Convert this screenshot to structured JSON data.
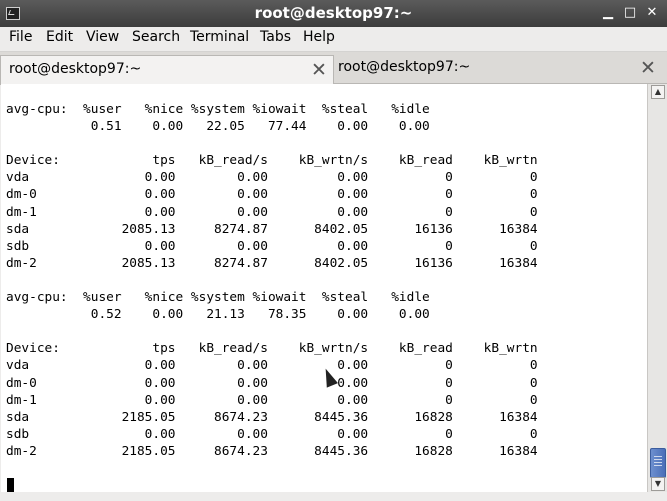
{
  "window": {
    "title": "root@desktop97:~"
  },
  "window_controls": {
    "minimize": "▁",
    "maximize": "□",
    "close": "✕"
  },
  "menu": [
    {
      "label": "File"
    },
    {
      "label": "Edit"
    },
    {
      "label": "View"
    },
    {
      "label": "Search"
    },
    {
      "label": "Terminal"
    },
    {
      "label": "Tabs"
    },
    {
      "label": "Help"
    }
  ],
  "tabs": [
    {
      "label": "root@desktop97:~",
      "close": "✕"
    },
    {
      "label": "root@desktop97:~",
      "close": "✕"
    }
  ],
  "terminal": {
    "output": "avg-cpu:  %user   %nice %system %iowait  %steal   %idle\n           0.51    0.00   22.05   77.44    0.00    0.00\n\nDevice:            tps   kB_read/s    kB_wrtn/s    kB_read    kB_wrtn\nvda               0.00        0.00         0.00          0          0\ndm-0              0.00        0.00         0.00          0          0\ndm-1              0.00        0.00         0.00          0          0\nsda            2085.13     8274.87      8402.05      16136      16384\nsdb               0.00        0.00         0.00          0          0\ndm-2           2085.13     8274.87      8402.05      16136      16384\n\navg-cpu:  %user   %nice %system %iowait  %steal   %idle\n           0.52    0.00   21.13   78.35    0.00    0.00\n\nDevice:            tps   kB_read/s    kB_wrtn/s    kB_read    kB_wrtn\nvda               0.00        0.00         0.00          0          0\ndm-0              0.00        0.00         0.00          0          0\ndm-1              0.00        0.00         0.00          0          0\nsda            2185.05     8674.23      8445.36      16828      16384\nsdb               0.00        0.00         0.00          0          0\ndm-2           2185.05     8674.23      8445.36      16828      16384"
  },
  "scrollbar": {
    "up": "▲",
    "down": "▼"
  }
}
